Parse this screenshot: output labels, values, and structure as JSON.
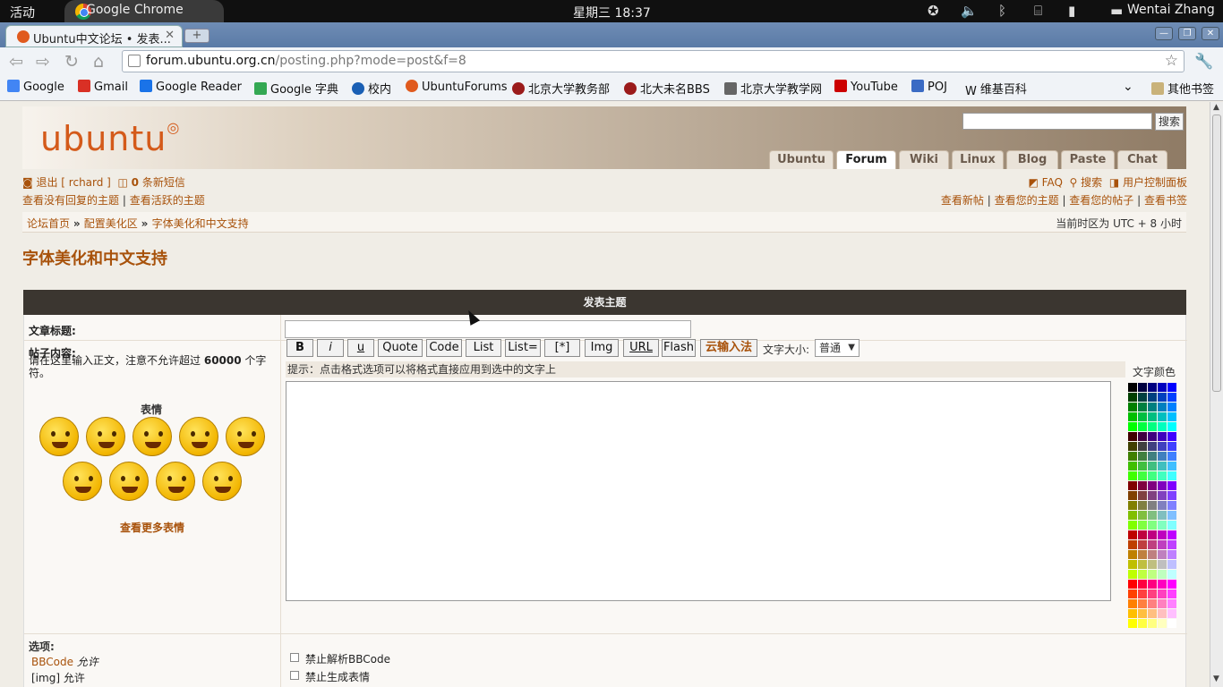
{
  "system": {
    "activities": "活动",
    "app_name": "Google Chrome",
    "clock": "星期三 18:37",
    "user": "Wentai Zhang"
  },
  "browser": {
    "tab_title": "Ubuntu中文论坛 • 发表...",
    "url_host": "forum.ubuntu.org.cn",
    "url_path": "/posting.php?mode=post&f=8",
    "bookmarks": [
      "Google",
      "Gmail",
      "Google Reader",
      "Google 字典",
      "校内",
      "UbuntuForums",
      "北京大学教务部",
      "北大未名BBS",
      "北京大学教学网",
      "YouTube",
      "POJ",
      "维基百科"
    ],
    "other_bookmarks": "其他书签"
  },
  "header": {
    "logo": "ubuntu",
    "search_button": "搜索",
    "nav_tabs": [
      "Ubuntu",
      "Forum",
      "Wiki",
      "Linux",
      "Blog",
      "Paste",
      "Chat"
    ],
    "active_tab": "Forum"
  },
  "userbar": {
    "logout": "退出 [ rchard ]",
    "pm_count": "0",
    "pm_label": "条新短信",
    "unanswered": "查看没有回复的主题",
    "active_topics": "查看活跃的主题",
    "faq": "FAQ",
    "search": "搜索",
    "ucp": "用户控制面板",
    "new_posts": "查看新帖",
    "your_topics": "查看您的主题",
    "your_posts": "查看您的帖子",
    "bookmarks": "查看书签"
  },
  "breadcrumb": {
    "items": [
      "论坛首页",
      "配置美化区",
      "字体美化和中文支持"
    ],
    "timezone": "当前时区为 UTC + 8 小时"
  },
  "page_title": "字体美化和中文支持",
  "form": {
    "header": "发表主题",
    "subject_label": "文章标题:",
    "body_label": "帖子内容:",
    "body_hint_pre": "请在这里输入正文，注意不允许超过",
    "body_hint_limit": "60000",
    "body_hint_post": "个字符。",
    "smiley_title": "表情",
    "more_smileys": "查看更多表情",
    "bbcode_buttons": [
      "B",
      "i",
      "u",
      "Quote",
      "Code",
      "List",
      "List=",
      "[*]",
      "Img",
      "URL",
      "Flash",
      "云输入法"
    ],
    "font_size_label": "文字大小:",
    "font_size_value": "普通",
    "tip": "提示：点击格式选项可以将格式直接应用到选中的文字上",
    "color_title": "文字颜色",
    "options_label": "选项:",
    "bbcode_status_link": "BBCode",
    "bbcode_status": "允许",
    "img_status": "[img] 允许",
    "options": [
      "禁止解析BBCode",
      "禁止生成表情"
    ]
  },
  "colors": {
    "accent": "#a8520b",
    "ubuntu_orange": "#d45a1a",
    "form_header": "#3b3630"
  }
}
